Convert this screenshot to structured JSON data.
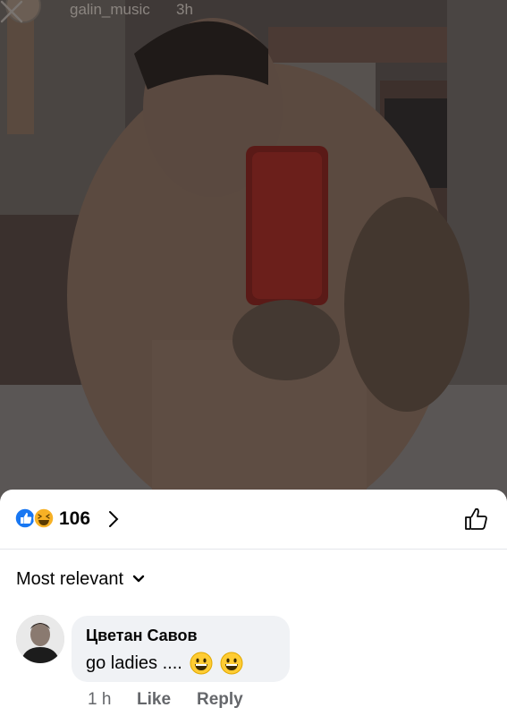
{
  "story": {
    "username": "galin_music",
    "time": "3h",
    "close_icon": "close-icon"
  },
  "reactions": {
    "icons": [
      "like-reaction-icon",
      "haha-reaction-icon"
    ],
    "count": "106",
    "like_color": "#1877f2",
    "haha_color": "#f7b125"
  },
  "sort": {
    "label": "Most relevant"
  },
  "comment": {
    "author": "Цветан Савов",
    "text": "go ladies ....",
    "emojis": [
      "grinning-face-emoji",
      "grinning-face-emoji"
    ],
    "time": "1 h",
    "like_label": "Like",
    "reply_label": "Reply"
  }
}
